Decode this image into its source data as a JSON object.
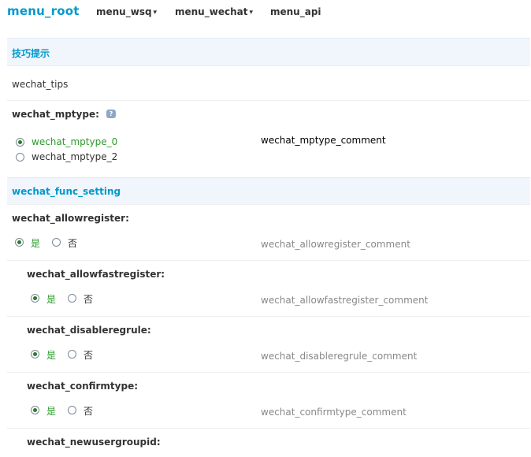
{
  "nav": {
    "brand": "menu_root",
    "items": [
      {
        "label": "menu_wsq",
        "caret": "▾"
      },
      {
        "label": "menu_wechat",
        "caret": "▾"
      },
      {
        "label": "menu_api",
        "caret": ""
      }
    ]
  },
  "sections": {
    "tips_header": "技巧提示",
    "func_header": "wechat_func_setting"
  },
  "tips_text": "wechat_tips",
  "mptype": {
    "label": "wechat_mptype:",
    "help_icon": "?",
    "options": [
      "wechat_mptype_0",
      "wechat_mptype_2"
    ],
    "selected": "wechat_mptype_0",
    "comment": "wechat_mptype_comment"
  },
  "settings": [
    {
      "label": "wechat_allowregister:",
      "yes": "是",
      "no": "否",
      "selected": "yes",
      "comment": "wechat_allowregister_comment"
    },
    {
      "label": "wechat_allowfastregister:",
      "yes": "是",
      "no": "否",
      "selected": "yes",
      "comment": "wechat_allowfastregister_comment"
    },
    {
      "label": "wechat_disableregrule:",
      "yes": "是",
      "no": "否",
      "selected": "yes",
      "comment": "wechat_disableregrule_comment"
    },
    {
      "label": "wechat_confirmtype:",
      "yes": "是",
      "no": "否",
      "selected": "yes",
      "comment": "wechat_confirmtype_comment"
    },
    {
      "label": "wechat_newusergroupid:"
    }
  ],
  "colors": {
    "accent": "#0099cc",
    "selected_option": "#2a9b2a",
    "header_bg": "#f1f6fd"
  }
}
